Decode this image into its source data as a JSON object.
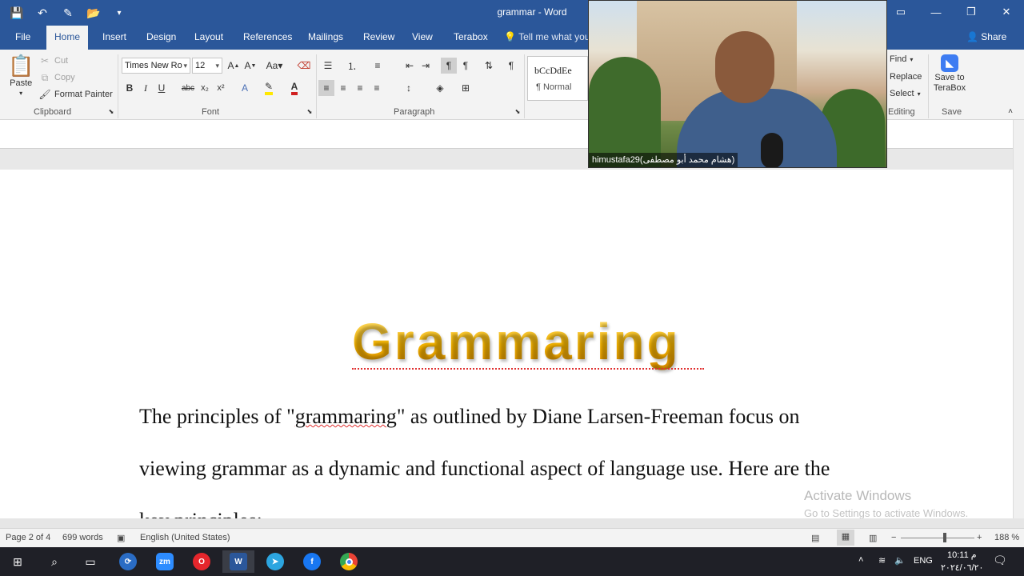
{
  "titlebar": {
    "title": "grammar - Word",
    "qat_icons": [
      "save-icon",
      "undo-icon",
      "edit-icon",
      "open-icon",
      "customize-icon"
    ]
  },
  "tabs": [
    "File",
    "Home",
    "Insert",
    "Design",
    "Layout",
    "References",
    "Mailings",
    "Review",
    "View",
    "Terabox"
  ],
  "active_tab": "Home",
  "tell_me": "Tell me what you",
  "share": "Share",
  "ribbon": {
    "clipboard": {
      "paste": "Paste",
      "cut": "Cut",
      "copy": "Copy",
      "format_painter": "Format Painter",
      "label": "Clipboard"
    },
    "font": {
      "font_name": "Times New Ro",
      "font_size": "12",
      "bold": "B",
      "italic": "I",
      "underline": "U",
      "strike": "abc",
      "subscript": "x₂",
      "superscript": "x²",
      "label": "Font"
    },
    "paragraph": {
      "label": "Paragraph"
    },
    "styles": {
      "sample": "bCcDdEe",
      "normal": "¶ Normal"
    },
    "editing": {
      "find": "Find",
      "replace": "Replace",
      "select": "Select",
      "label": "Editing"
    },
    "save": {
      "save_to": "Save to",
      "terabox": "TeraBox",
      "label": "Save"
    }
  },
  "document": {
    "title": "Grammaring",
    "line1_pre": "The principles of \"",
    "line1_word": "grammaring",
    "line1_post": "\" as outlined by Diane Larsen-Freeman focus on",
    "line2": "viewing grammar as a dynamic and functional aspect of language use. Here are the",
    "line3": "key principles:"
  },
  "watermark": {
    "line1": "Activate Windows",
    "line2": "Go to Settings to activate Windows."
  },
  "video": {
    "name": "himustafa29(هشام محمد أبو مصطفى)"
  },
  "status": {
    "page": "Page 2 of 4",
    "words": "699 words",
    "language": "English (United States)",
    "zoom": "188 %"
  },
  "taskbar": {
    "lang": "ENG",
    "time": "10:11 م",
    "date": "٢٠٢٤/٠٦/٢٠"
  }
}
